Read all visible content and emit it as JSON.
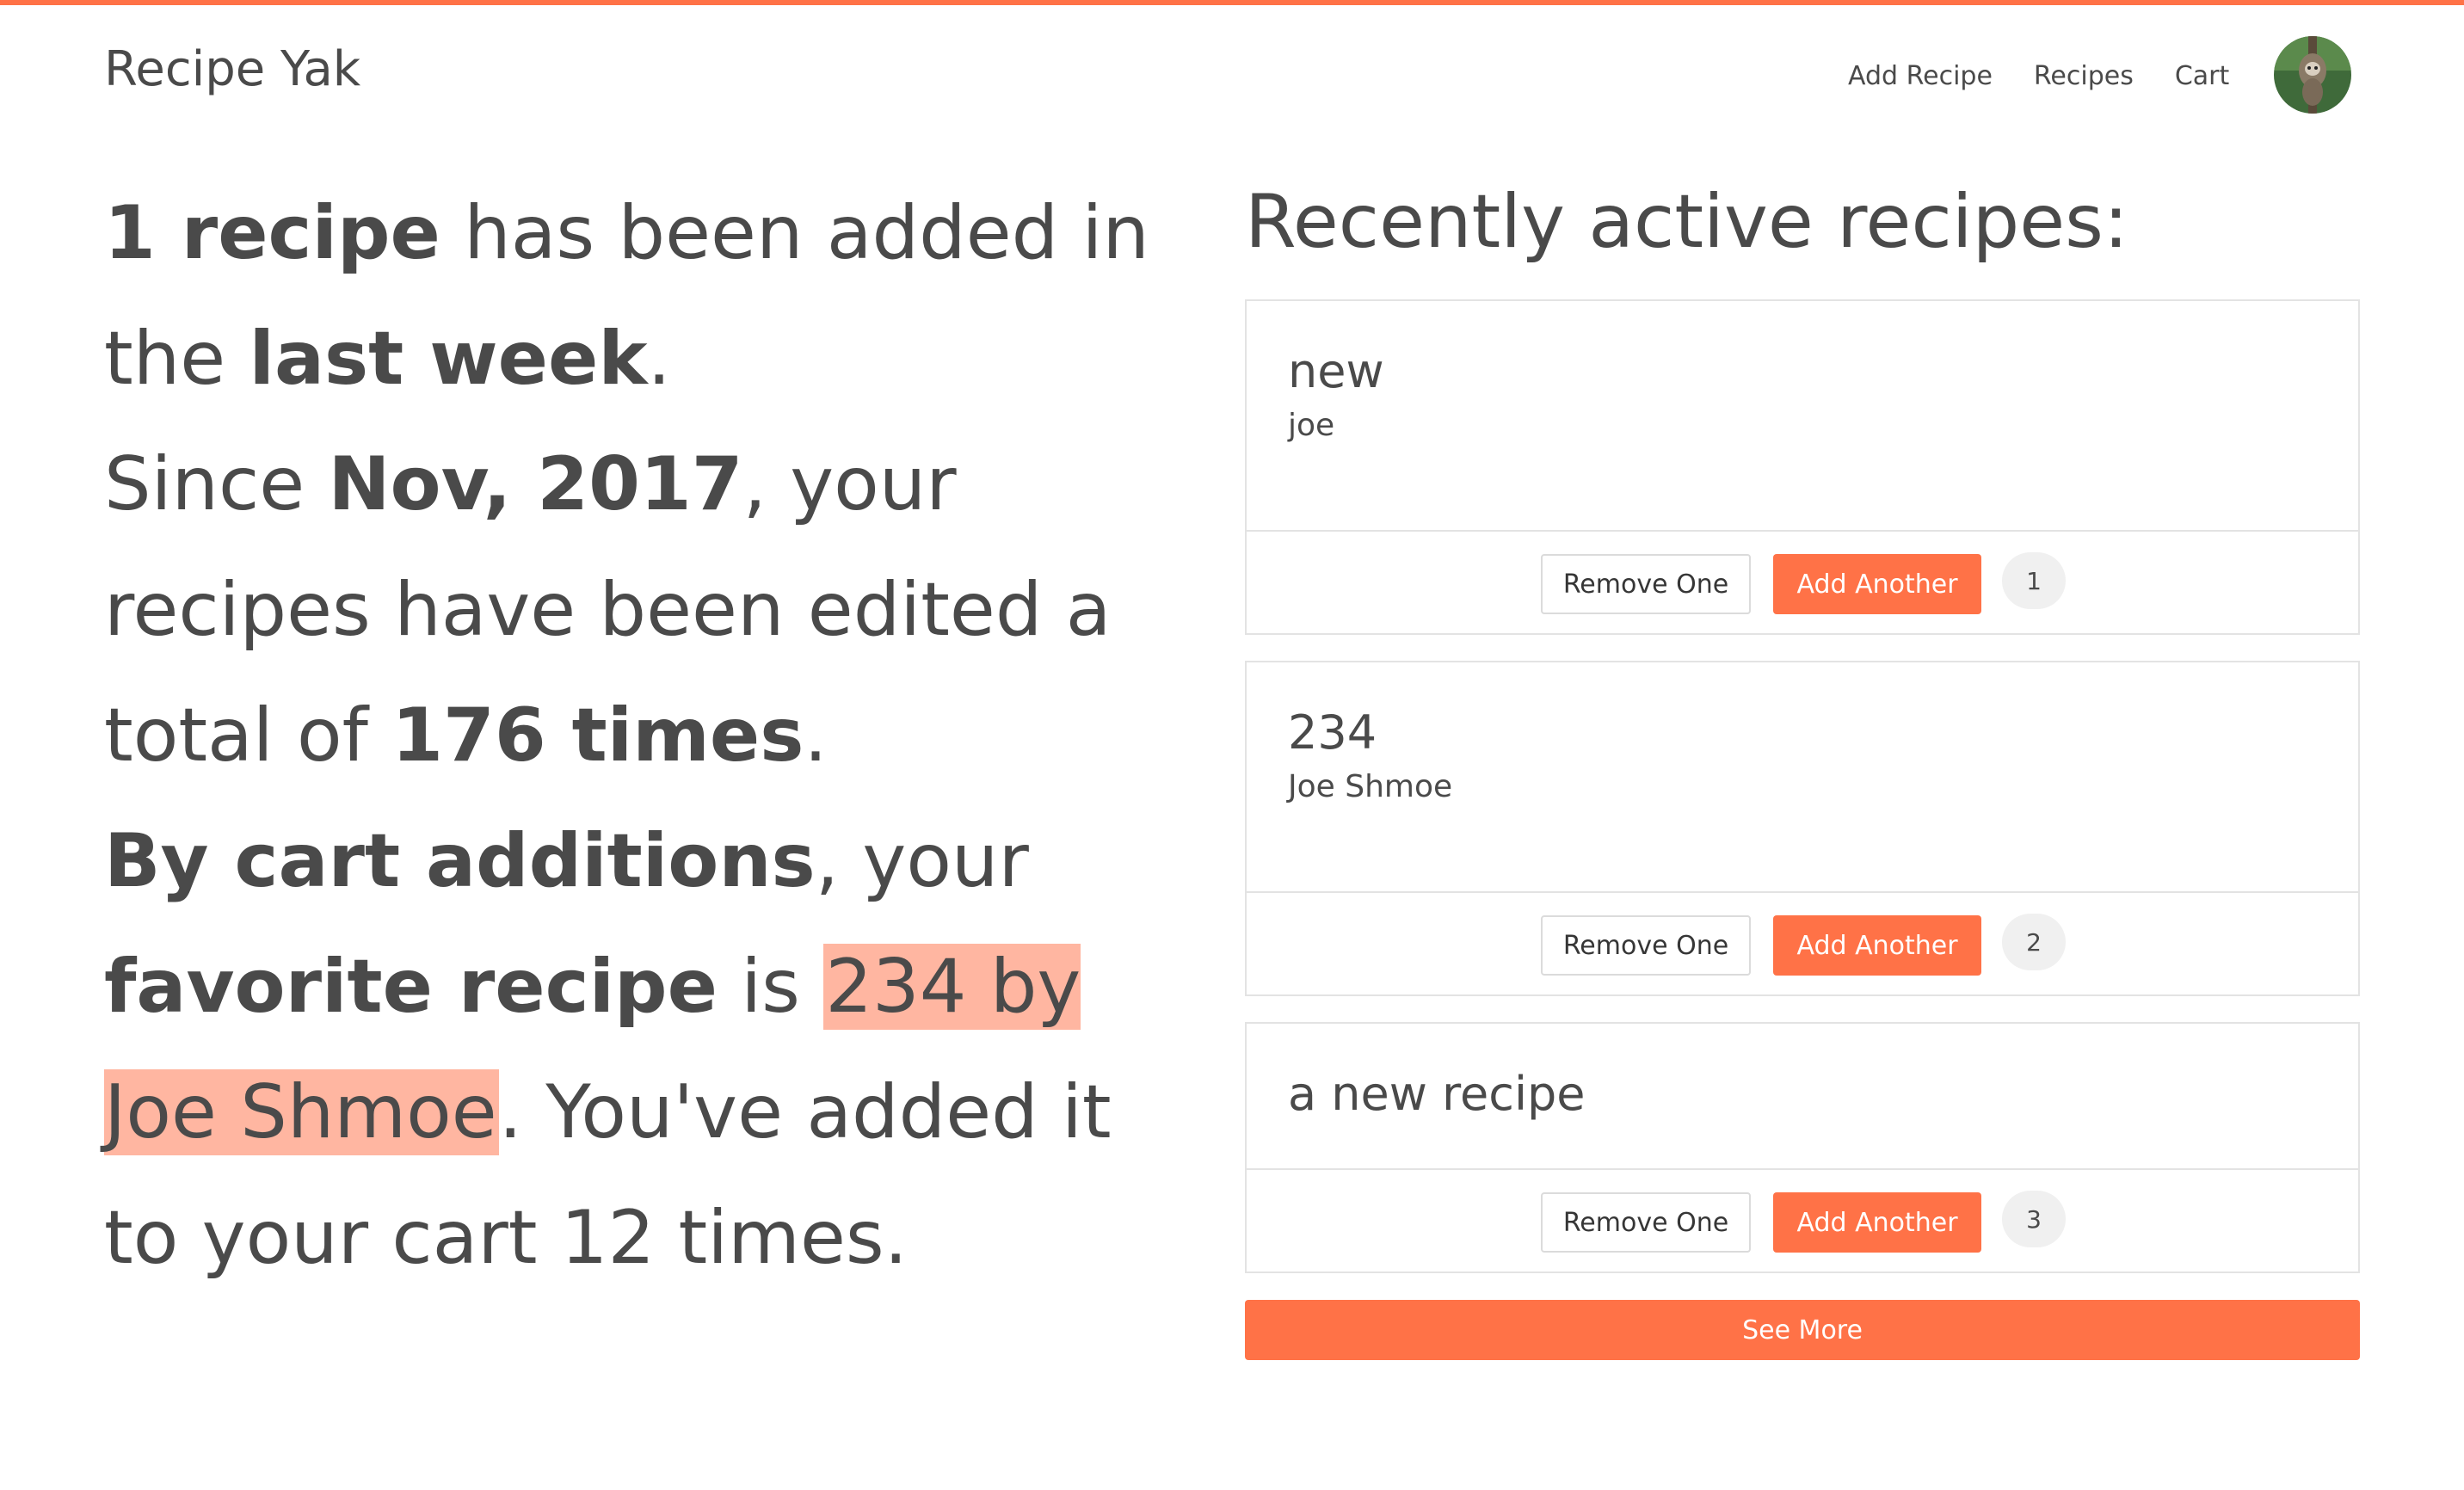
{
  "header": {
    "brand": "Recipe Yak",
    "nav": [
      "Add Recipe",
      "Recipes",
      "Cart"
    ],
    "accent_color": "#ff7247"
  },
  "stats": {
    "line1": {
      "count": "1 recipe",
      "mid": " has been added in the ",
      "period": "last week",
      "end": "."
    },
    "line2": {
      "pre": "Since ",
      "date": "Nov, 2017",
      "mid": ", your recipes have been edited a total of ",
      "times": "176 times",
      "end": "."
    },
    "line3": {
      "by": "By cart additions",
      "comma": ", your ",
      "fav": "favorite recipe",
      "is": " is ",
      "highlight": "234 by Joe Shmoe",
      "end": ". You've added it to your cart 12 times."
    },
    "highlight_color": "#ffb6a1"
  },
  "recent": {
    "title": "Recently active recipes:",
    "remove_label": "Remove One",
    "add_label": "Add Another",
    "items": [
      {
        "name": "new",
        "author": "joe",
        "count": "1"
      },
      {
        "name": "234",
        "author": "Joe Shmoe",
        "count": "2"
      },
      {
        "name": "a new recipe",
        "author": "",
        "count": "3"
      }
    ],
    "see_more": "See More"
  }
}
